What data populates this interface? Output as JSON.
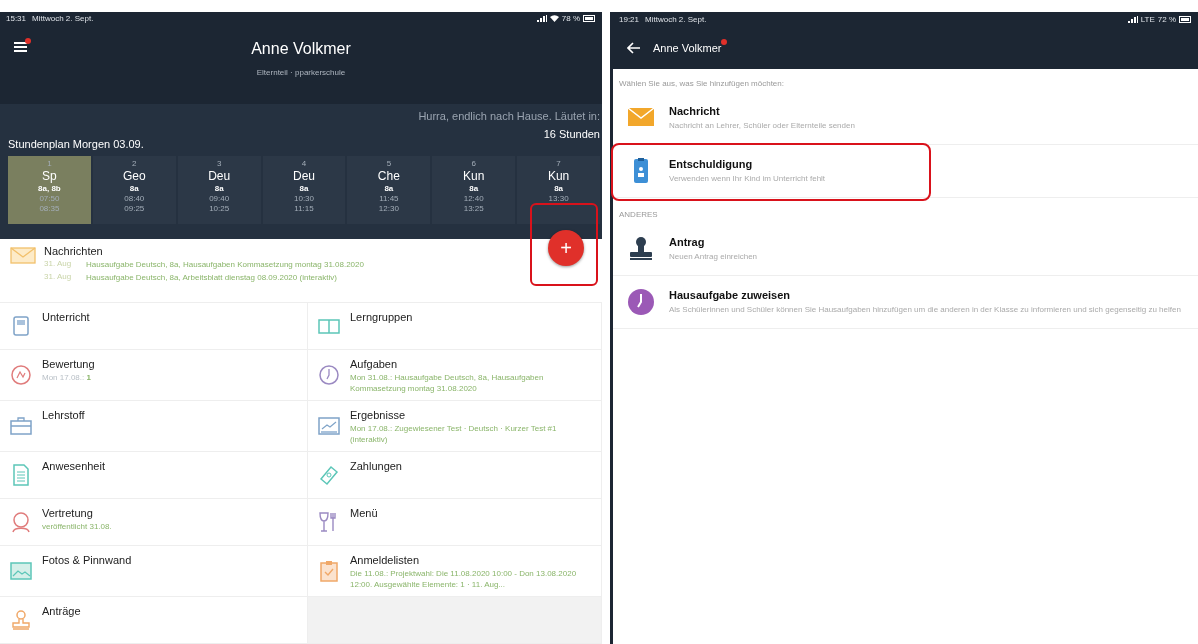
{
  "left": {
    "status_bar": {
      "time": "15:31",
      "date": "Mittwoch 2. Sept.",
      "battery": "78 %"
    },
    "header": {
      "title": "Anne Volkmer",
      "subtitle": "Elternteil · pparkerschule",
      "menu_badge": true
    },
    "countdown": {
      "message": "Hurra, endlich nach Hause. Läutet in:",
      "value": "16 Stunden"
    },
    "timetable": {
      "title": "Stundenplan Morgen 03.09.",
      "lessons": [
        {
          "number": "1",
          "subject": "Sp",
          "class": "8a, 8b",
          "start": "07:50",
          "end": "08:35",
          "selected": true
        },
        {
          "number": "2",
          "subject": "Geo",
          "class": "8a",
          "start": "08:40",
          "end": "09:25",
          "selected": false
        },
        {
          "number": "3",
          "subject": "Deu",
          "class": "8a",
          "start": "09:40",
          "end": "10:25",
          "selected": false
        },
        {
          "number": "4",
          "subject": "Deu",
          "class": "8a",
          "start": "10:30",
          "end": "11:15",
          "selected": false
        },
        {
          "number": "5",
          "subject": "Che",
          "class": "8a",
          "start": "11:45",
          "end": "12:30",
          "selected": false
        },
        {
          "number": "6",
          "subject": "Kun",
          "class": "8a",
          "start": "12:40",
          "end": "13:25",
          "selected": false
        },
        {
          "number": "7",
          "subject": "Kun",
          "class": "8a",
          "start": "13:30",
          "selected": false
        }
      ]
    },
    "fab": {
      "label": "+",
      "highlighted": true
    },
    "messages": {
      "title": "Nachrichten",
      "items": [
        {
          "date": "31. Aug",
          "text": "Hausaufgabe Deutsch, 8a, Hausaufgaben Kommasetzung montag 31.08.2020"
        },
        {
          "date": "31. Aug",
          "text": "Hausaufgabe Deutsch, 8a, Arbeitsblatt dienstag 08.09.2020 (interaktiv)"
        }
      ]
    },
    "tiles": [
      {
        "kind": "lesson",
        "title": "Unterricht"
      },
      {
        "kind": "book",
        "title": "Lerngruppen"
      },
      {
        "kind": "grade",
        "title": "Bewertung",
        "subtitle": "Mon 17.08.: **1**",
        "muted": true
      },
      {
        "kind": "clock",
        "title": "Aufgaben",
        "subtitle": "Mon 31.08.: Hausaufgabe Deutsch, 8a, Hausaufgaben Kommasetzung montag 31.08.2020"
      },
      {
        "kind": "case",
        "title": "Lehrstoff"
      },
      {
        "kind": "chart",
        "title": "Ergebnisse",
        "subtitle": "Mon 17.08.: Zugewiesener Test · Deutsch · Kurzer Test #1 (interaktiv)"
      },
      {
        "kind": "sheet",
        "title": "Anwesenheit"
      },
      {
        "kind": "money",
        "title": "Zahlungen"
      },
      {
        "kind": "person",
        "title": "Vertretung",
        "subtitle": "veröffentlicht 31.08."
      },
      {
        "kind": "menu",
        "title": "Menü"
      },
      {
        "kind": "photo",
        "title": "Fotos & Pinnwand"
      },
      {
        "kind": "clipboard",
        "title": "Anmeldelisten",
        "subtitle": "Die 11.08.: Projektwahl: Die 11.08.2020 10:00 - Don 13.08.2020 12:00. Ausgewählte Elemente: 1 · 11. Aug..."
      },
      {
        "kind": "stamp",
        "title": "Anträge"
      }
    ]
  },
  "right": {
    "status_bar": {
      "time": "19:21",
      "date": "Mittwoch 2. Sept.",
      "network": "LTE",
      "battery": "72 %"
    },
    "header": {
      "title": "Anne Volkmer",
      "badge": true
    },
    "prompt": "Wählen Sie aus, was Sie hinzufügen möchten:",
    "items": [
      {
        "kind": "mail",
        "title": "Nachricht",
        "description": "Nachricht an Lehrer, Schüler oder Elternteile senden",
        "highlighted": false
      },
      {
        "kind": "excuse",
        "title": "Entschuldigung",
        "description": "Verwenden wenn Ihr Kind im Unterricht fehlt",
        "highlighted": true
      }
    ],
    "section_label": "ANDERES",
    "other_items": [
      {
        "kind": "stamp",
        "title": "Antrag",
        "description": "Neuen Antrag einreichen",
        "highlighted": false
      },
      {
        "kind": "clock",
        "title": "Hausaufgabe zuweisen",
        "description": "Als Schülerinnen und Schüler können Sie Hausaufgaben hinzufügen um die anderen in der Klasse zu informieren und sich gegenseitig zu helfen",
        "highlighted": false
      }
    ]
  }
}
